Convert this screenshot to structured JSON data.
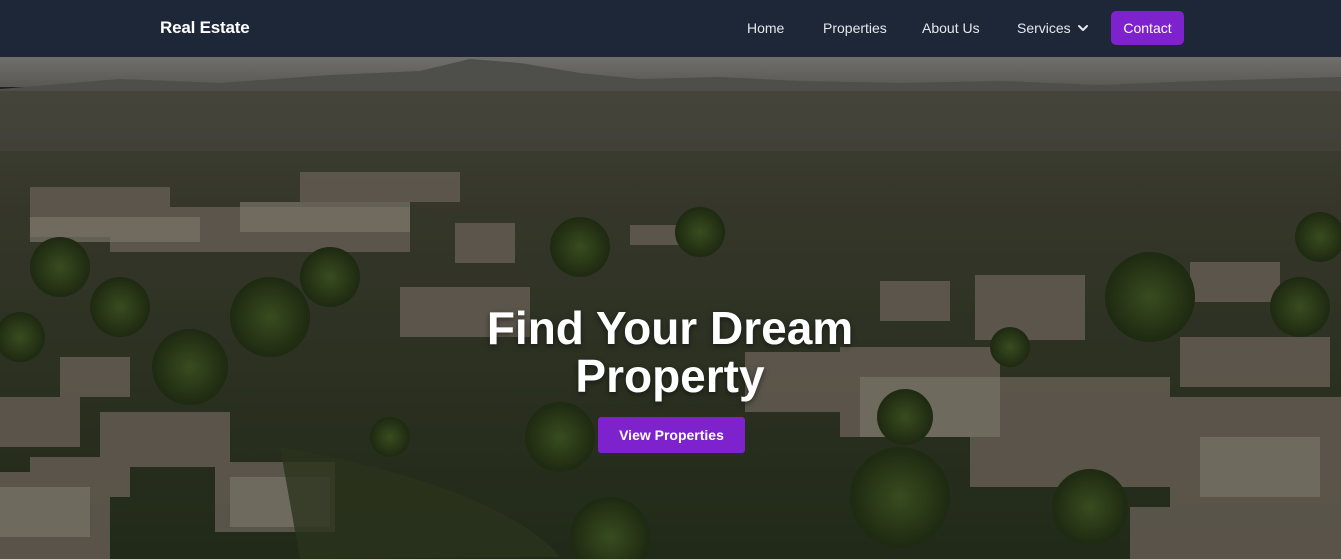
{
  "navbar": {
    "brand": "Real Estate",
    "links": [
      {
        "label": "Home"
      },
      {
        "label": "Properties"
      },
      {
        "label": "About Us"
      },
      {
        "label": "Services"
      }
    ],
    "contact_label": "Contact",
    "services_icon": "chevron-down-icon"
  },
  "hero": {
    "title": "Find Your Dream Property",
    "button_label": "View Properties"
  },
  "colors": {
    "navbar_bg": "#1e2738",
    "accent": "#7e22ce",
    "text": "#ffffff"
  }
}
